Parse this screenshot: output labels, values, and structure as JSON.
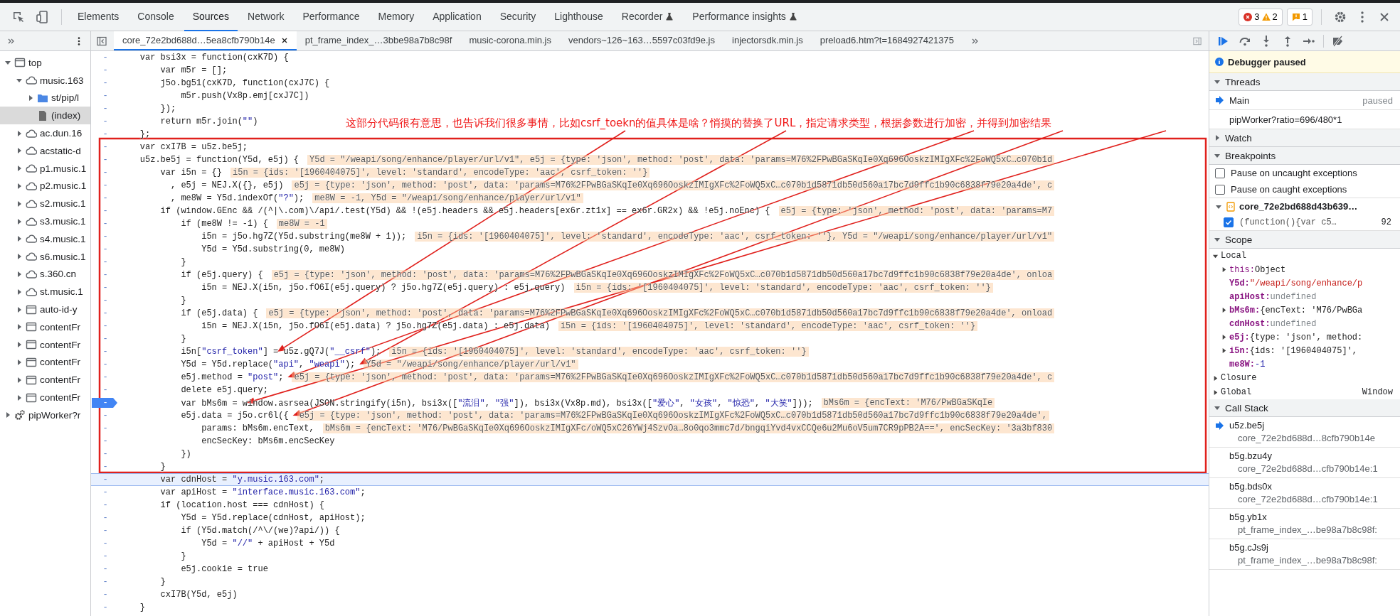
{
  "toolbar": {
    "tabs": [
      {
        "label": "Elements",
        "selected": false,
        "experimental": false
      },
      {
        "label": "Console",
        "selected": false,
        "experimental": false
      },
      {
        "label": "Sources",
        "selected": true,
        "experimental": false
      },
      {
        "label": "Network",
        "selected": false,
        "experimental": false
      },
      {
        "label": "Performance",
        "selected": false,
        "experimental": false
      },
      {
        "label": "Memory",
        "selected": false,
        "experimental": false
      },
      {
        "label": "Application",
        "selected": false,
        "experimental": false
      },
      {
        "label": "Security",
        "selected": false,
        "experimental": false
      },
      {
        "label": "Lighthouse",
        "selected": false,
        "experimental": false
      },
      {
        "label": "Recorder",
        "selected": false,
        "experimental": true
      },
      {
        "label": "Performance insights",
        "selected": false,
        "experimental": true
      }
    ],
    "errors": "3",
    "warnings": "2",
    "issues": "1"
  },
  "sidebar": {
    "tree": [
      {
        "label": "top",
        "kind": "frame",
        "expanded": true,
        "selected": false,
        "children": [
          {
            "label": "music.163",
            "kind": "cloud",
            "expanded": true,
            "selected": false,
            "children": [
              {
                "label": "st/pip/l",
                "kind": "folder",
                "expanded": false,
                "selected": false
              },
              {
                "label": "(index)",
                "kind": "file",
                "selected": true
              }
            ]
          },
          {
            "label": "ac.dun.16",
            "kind": "cloud",
            "expanded": false,
            "selected": false
          },
          {
            "label": "acstatic-d",
            "kind": "cloud",
            "expanded": false,
            "selected": false
          },
          {
            "label": "p1.music.1",
            "kind": "cloud",
            "expanded": false,
            "selected": false
          },
          {
            "label": "p2.music.1",
            "kind": "cloud",
            "expanded": false,
            "selected": false
          },
          {
            "label": "s2.music.1",
            "kind": "cloud",
            "expanded": false,
            "selected": false
          },
          {
            "label": "s3.music.1",
            "kind": "cloud",
            "expanded": false,
            "selected": false
          },
          {
            "label": "s4.music.1",
            "kind": "cloud",
            "expanded": false,
            "selected": false
          },
          {
            "label": "s6.music.1",
            "kind": "cloud",
            "expanded": false,
            "selected": false
          },
          {
            "label": "s.360.cn",
            "kind": "cloud",
            "expanded": false,
            "selected": false
          },
          {
            "label": "st.music.1",
            "kind": "cloud",
            "expanded": false,
            "selected": false
          },
          {
            "label": "auto-id-y",
            "kind": "frame",
            "expanded": false,
            "selected": false
          },
          {
            "label": "contentFr",
            "kind": "frame",
            "expanded": false,
            "selected": false
          },
          {
            "label": "contentFr",
            "kind": "frame",
            "expanded": false,
            "selected": false
          },
          {
            "label": "contentFr",
            "kind": "frame",
            "expanded": false,
            "selected": false
          },
          {
            "label": "contentFr",
            "kind": "frame",
            "expanded": false,
            "selected": false
          },
          {
            "label": "contentFr",
            "kind": "frame",
            "expanded": false,
            "selected": false
          }
        ]
      },
      {
        "label": "pipWorker?r",
        "kind": "gear",
        "expanded": false,
        "selected": false
      }
    ]
  },
  "editor": {
    "tabs": [
      {
        "label": "core_72e2bd688d…5ea8cfb790b14e",
        "selected": true,
        "closable": true
      },
      {
        "label": "pt_frame_index_…3bbe98a7b8c98f",
        "selected": false,
        "closable": false
      },
      {
        "label": "music-corona.min.js",
        "selected": false,
        "closable": false
      },
      {
        "label": "vendors~126~163…5597c03fd9e.js",
        "selected": false,
        "closable": false
      },
      {
        "label": "injectorsdk.min.js",
        "selected": false,
        "closable": false
      },
      {
        "label": "preload6.htm?t=1684927421375",
        "selected": false,
        "closable": false
      }
    ],
    "lines": [
      {
        "gutter": "-",
        "code": "    var bsi3x = function(cxK7D) {"
      },
      {
        "gutter": "-",
        "code": "        var m5r = [];"
      },
      {
        "gutter": "-",
        "code": "        j5o.bg51(cxK7D, function(cxJ7C) {"
      },
      {
        "gutter": "-",
        "code": "            m5r.push(Vx8p.emj[cxJ7C])"
      },
      {
        "gutter": "-",
        "code": "        });"
      },
      {
        "gutter": "-",
        "code": "        return m5r.join(\"\")"
      },
      {
        "gutter": "-",
        "code": "    };"
      },
      {
        "gutter": "-",
        "code": "    var cxI7B = u5z.be5j;"
      },
      {
        "gutter": "-",
        "code": "    u5z.be5j = function(Y5d, e5j) {",
        "value": "Y5d = \"/weapi/song/enhance/player/url/v1\", e5j = {type: 'json', method: 'post', data: 'params=M76%2FPwBGaSKqIe0Xq696OoskzIMIgXFc%2FoWQ5xC…c070b1d"
      },
      {
        "gutter": "-",
        "code": "        var i5n = {}",
        "value": "i5n = {ids: '[1960404075]', level: 'standard', encodeType: 'aac', csrf_token: ''}"
      },
      {
        "gutter": "-",
        "code": "          , e5j = NEJ.X({}, e5j)",
        "value": "e5j = {type: 'json', method: 'post', data: 'params=M76%2FPwBGaSKqIe0Xq696OoskzIMIgXFc%2FoWQ5xC…c070b1d5871db50d560a17bc7d9ffc1b90c6838f79e20a4de', c"
      },
      {
        "gutter": "-",
        "code": "          , me8W = Y5d.indexOf(\"?\");",
        "value": "me8W = -1, Y5d = \"/weapi/song/enhance/player/url/v1\""
      },
      {
        "gutter": "-",
        "code": "        if (window.GEnc && /(^|\\.com)\\/api/.test(Y5d) && !(e5j.headers && e5j.headers[ex6r.zt1x] == ex6r.GR2x) && !e5j.noEnc) {",
        "value": "e5j = {type: 'json', method: 'post', data: 'params=M7"
      },
      {
        "gutter": "-",
        "code": "            if (me8W != -1) {",
        "value": "me8W = -1"
      },
      {
        "gutter": "-",
        "code": "                i5n = j5o.hg7Z(Y5d.substring(me8W + 1));",
        "value": "i5n = {ids: '[1960404075]', level: 'standard', encodeType: 'aac', csrf_token: ''}, Y5d = \"/weapi/song/enhance/player/url/v1\""
      },
      {
        "gutter": "-",
        "code": "                Y5d = Y5d.substring(0, me8W)"
      },
      {
        "gutter": "-",
        "code": "            }"
      },
      {
        "gutter": "-",
        "code": "            if (e5j.query) {",
        "value": "e5j = {type: 'json', method: 'post', data: 'params=M76%2FPwBGaSKqIe0Xq696OoskzIMIgXFc%2FoWQ5xC…c070b1d5871db50d560a17bc7d9ffc1b90c6838f79e20a4de', onloa"
      },
      {
        "gutter": "-",
        "code": "                i5n = NEJ.X(i5n, j5o.fO6I(e5j.query) ? j5o.hg7Z(e5j.query) : e5j.query)",
        "value": "i5n = {ids: '[1960404075]', level: 'standard', encodeType: 'aac', csrf_token: ''}"
      },
      {
        "gutter": "-",
        "code": "            }"
      },
      {
        "gutter": "-",
        "code": "            if (e5j.data) {",
        "value": "e5j = {type: 'json', method: 'post', data: 'params=M76%2FPwBGaSKqIe0Xq696OoskzIMIgXFc%2FoWQ5xC…c070b1d5871db50d560a17bc7d9ffc1b90c6838f79e20a4de', onload"
      },
      {
        "gutter": "-",
        "code": "                i5n = NEJ.X(i5n, j5o.fO6I(e5j.data) ? j5o.hg7Z(e5j.data) : e5j.data)",
        "value": "i5n = {ids: '[1960404075]', level: 'standard', encodeType: 'aac', csrf_token: ''}"
      },
      {
        "gutter": "-",
        "code": "            }"
      },
      {
        "gutter": "-",
        "code": "            i5n[\"csrf_token\"] = u5z.gQ7J(\"__csrf\");",
        "value": "i5n = {ids: '[1960404075]', level: 'standard', encodeType: 'aac', csrf_token: ''}"
      },
      {
        "gutter": "-",
        "code": "            Y5d = Y5d.replace(\"api\", \"weapi\");",
        "value": "Y5d = \"/weapi/song/enhance/player/url/v1\""
      },
      {
        "gutter": "-",
        "code": "            e5j.method = \"post\";",
        "value": "e5j = {type: 'json', method: 'post', data: 'params=M76%2FPwBGaSKqIe0Xq696OoskzIMIgXFc%2FoWQ5xC…c070b1d5871db50d560a17bc7d9ffc1b90c6838f79e20a4de', c"
      },
      {
        "gutter": "-",
        "code": "            delete e5j.query;"
      },
      {
        "gutter": "-",
        "code": "            var bMs6m = window.asrsea(JSON.stringify(i5n), bsi3x([\"流泪\", \"强\"]), bsi3x(Vx8p.md), bsi3x([\"爱心\", \"女孩\", \"惊恐\", \"大笑\"]));",
        "value": "bMs6m = {encText: 'M76/PwBGaSKqIe",
        "breakpoint": true
      },
      {
        "gutter": "-",
        "code": "            e5j.data = j5o.cr6l({",
        "value": "e5j = {type: 'json', method: 'post', data: 'params=M76%2FPwBGaSKqIe0Xq696OoskzIMIgXFc%2FoWQ5xC…c070b1d5871db50d560a17bc7d9ffc1b90c6838f79e20a4de',"
      },
      {
        "gutter": "-",
        "code": "                params: bMs6m.encText,",
        "value": "bMs6m = {encText: 'M76/PwBGaSKqIe0Xq696OoskzIMIgXFc/oWQ5xC26YWj4SzvOa…8o0qo3mmc7d/bngqiYvd4vxCCQe6u2Mu6oV5um7CR9pPB2A==', encSecKey: '3a3bf830"
      },
      {
        "gutter": "-",
        "code": "                encSecKey: bMs6m.encSecKey"
      },
      {
        "gutter": "-",
        "code": "            })"
      },
      {
        "gutter": "-",
        "code": "        }"
      },
      {
        "gutter": "-",
        "code": "        var cdnHost = \"y.music.163.com\";",
        "highlighted": true
      },
      {
        "gutter": "-",
        "code": "        var apiHost = \"interface.music.163.com\";"
      },
      {
        "gutter": "-",
        "code": "        if (location.host === cdnHost) {"
      },
      {
        "gutter": "-",
        "code": "            Y5d = Y5d.replace(cdnHost, apiHost);"
      },
      {
        "gutter": "-",
        "code": "            if (Y5d.match(/^\\/(we)?api/)) {"
      },
      {
        "gutter": "-",
        "code": "                Y5d = \"//\" + apiHost + Y5d"
      },
      {
        "gutter": "-",
        "code": "            }"
      },
      {
        "gutter": "-",
        "code": "            e5j.cookie = true"
      },
      {
        "gutter": "-",
        "code": "        }"
      },
      {
        "gutter": "-",
        "code": "        cxI7B(Y5d, e5j)"
      },
      {
        "gutter": "-",
        "code": "    }"
      }
    ],
    "annotation": {
      "text": "这部分代码很有意思，也告诉我们很多事情，比如csrf_toekn的值具体是啥？悄摸的替换了URL，指定请求类型，根据参数进行加密，并得到加密结果"
    }
  },
  "debugger": {
    "banner": "Debugger paused",
    "threads": {
      "title": "Threads",
      "expanded": true,
      "items": [
        {
          "name": "Main",
          "status": "paused",
          "selected": true
        },
        {
          "name": "pipWorker?ratio=696/480*1",
          "selected": false
        }
      ]
    },
    "watch": {
      "title": "Watch",
      "expanded": false
    },
    "breakpoints": {
      "title": "Breakpoints",
      "expanded": true,
      "options": [
        {
          "label": "Pause on uncaught exceptions",
          "checked": false
        },
        {
          "label": "Pause on caught exceptions",
          "checked": false
        }
      ],
      "files": [
        {
          "name": "core_72e2bd688d43b639…",
          "expanded": true,
          "items": [
            {
              "code": "(function(){var c5…",
              "line": "92",
              "checked": true
            }
          ]
        }
      ]
    },
    "scope": {
      "title": "Scope",
      "expanded": true,
      "groups": [
        {
          "name": "Local",
          "expanded": true,
          "props": [
            {
              "name": "this:",
              "value": "Object",
              "kind": "object",
              "expandable": true
            },
            {
              "name": "Y5d:",
              "value": "\"/weapi/song/enhance/p",
              "kind": "string",
              "expandable": false
            },
            {
              "name": "apiHost:",
              "value": "undefined",
              "kind": "undefined",
              "expandable": false
            },
            {
              "name": "bMs6m:",
              "value": "{encText: 'M76/PwBGa",
              "kind": "object",
              "expandable": true
            },
            {
              "name": "cdnHost:",
              "value": "undefined",
              "kind": "undefined",
              "expandable": false
            },
            {
              "name": "e5j:",
              "value": "{type: 'json', method:",
              "kind": "object",
              "expandable": true
            },
            {
              "name": "i5n:",
              "value": "{ids: '[1960404075]',",
              "kind": "object",
              "expandable": true
            },
            {
              "name": "me8W:",
              "value": "-1",
              "kind": "number",
              "expandable": false
            }
          ]
        },
        {
          "name": "Closure",
          "expanded": false
        },
        {
          "name": "Global",
          "expanded": false,
          "value": "Window"
        }
      ]
    },
    "call_stack": {
      "title": "Call Stack",
      "expanded": true,
      "frames": [
        {
          "name": "u5z.be5j",
          "location": "core_72e2bd688d…8cfb790b14e",
          "selected": true
        },
        {
          "name": "b5g.bzu4y",
          "location": "core_72e2bd688d…cfb790b14e:1",
          "selected": false
        },
        {
          "name": "b5g.bds0x",
          "location": "core_72e2bd688d…cfb790b14e:1",
          "selected": false
        },
        {
          "name": "b5g.yb1x",
          "location": "pt_frame_index_…be98a7b8c98f:",
          "selected": false
        },
        {
          "name": "b5g.cJs9j",
          "location": "pt_frame_index_…be98a7b8c98f:",
          "selected": false
        }
      ]
    }
  }
}
